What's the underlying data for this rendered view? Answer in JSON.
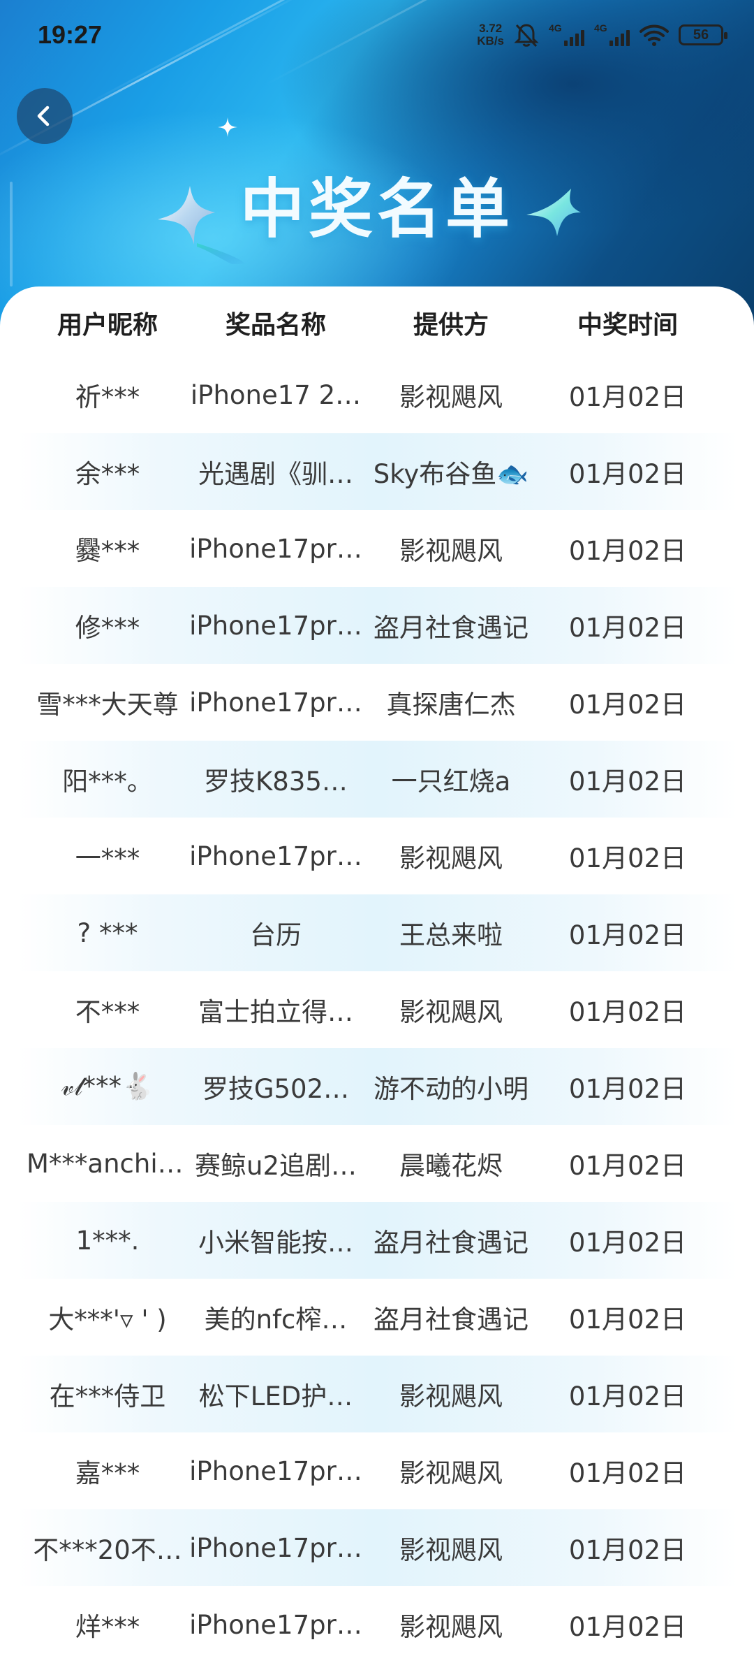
{
  "status_bar": {
    "time": "19:27",
    "net_speed_value": "3.72",
    "net_speed_unit": "KB/s",
    "signal_1_label": "4G",
    "signal_2_label": "4G",
    "battery": "56"
  },
  "header": {
    "title": "中奖名单"
  },
  "table": {
    "columns": [
      "用户昵称",
      "奖品名称",
      "提供方",
      "中奖时间"
    ],
    "rows": [
      {
        "user": "祈***",
        "prize": "iPhone17 2…",
        "provider": "影视飓风",
        "time": "01月02日"
      },
      {
        "user": "余***",
        "prize": "光遇剧《驯…",
        "provider": "Sky布谷鱼🐟",
        "time": "01月02日"
      },
      {
        "user": "爨***",
        "prize": "iPhone17pr…",
        "provider": "影视飓风",
        "time": "01月02日"
      },
      {
        "user": "修***",
        "prize": "iPhone17pr…",
        "provider": "盗月社食遇记",
        "time": "01月02日"
      },
      {
        "user": "雪***大天尊",
        "prize": "iPhone17pr…",
        "provider": "真探唐仁杰",
        "time": "01月02日"
      },
      {
        "user": "阳***。",
        "prize": "罗技K835…",
        "provider": "一只红烧a",
        "time": "01月02日"
      },
      {
        "user": "一***",
        "prize": "iPhone17pr…",
        "provider": "影视飓风",
        "time": "01月02日"
      },
      {
        "user": "? ***",
        "prize": "台历",
        "provider": "王总来啦",
        "time": "01月02日"
      },
      {
        "user": "不***",
        "prize": "富士拍立得…",
        "provider": "影视飓风",
        "time": "01月02日"
      },
      {
        "user": "𝓋𝓁***🐇",
        "prize": "罗技G502…",
        "provider": "游不动的小明",
        "time": "01月02日"
      },
      {
        "user": "M***anchiᵉ…",
        "prize": "赛鲸u2追剧…",
        "provider": "晨曦花烬",
        "time": "01月02日"
      },
      {
        "user": "1***.",
        "prize": "小米智能按…",
        "provider": "盗月社食遇记",
        "time": "01月02日"
      },
      {
        "user": "大***'▿ ' )",
        "prize": "美的nfc榨…",
        "provider": "盗月社食遇记",
        "time": "01月02日"
      },
      {
        "user": "在***侍卫",
        "prize": "松下LED护…",
        "provider": "影视飓风",
        "time": "01月02日"
      },
      {
        "user": "嘉***",
        "prize": "iPhone17pr…",
        "provider": "影视飓风",
        "time": "01月02日"
      },
      {
        "user": "不***20不…",
        "prize": "iPhone17pr…",
        "provider": "影视飓风",
        "time": "01月02日"
      },
      {
        "user": "烊***",
        "prize": "iPhone17pr…",
        "provider": "影视飓风",
        "time": "01月02日"
      }
    ]
  },
  "icons": {
    "back": "chevron-left-icon",
    "mute": "bell-off-icon",
    "wifi": "wifi-icon",
    "stars": "sparkle-star-icon"
  },
  "colors": {
    "header_blue": "#1a9ee6",
    "header_dark": "#0a3f6c",
    "title_text": "#f2fbff",
    "row_highlight": "#e2f4fc"
  }
}
